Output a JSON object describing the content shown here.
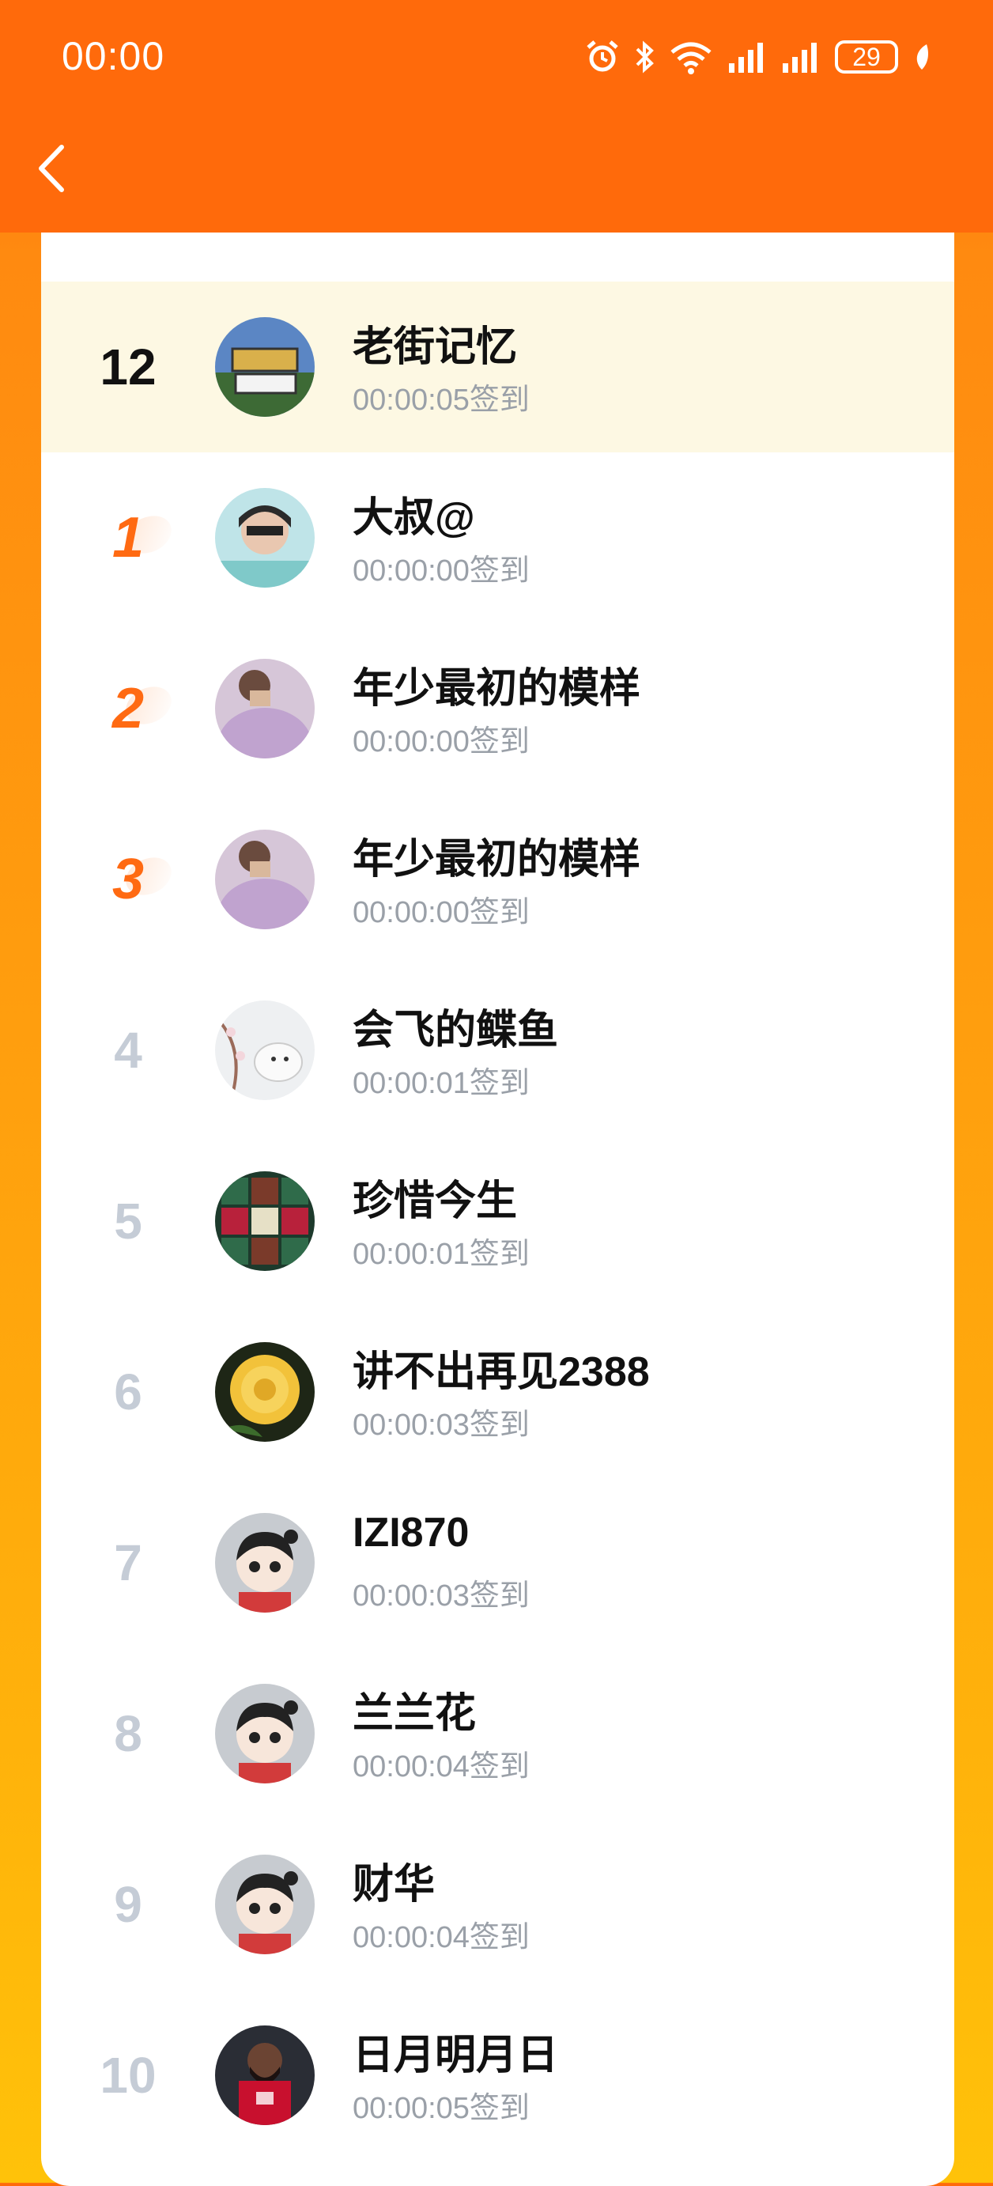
{
  "status_bar": {
    "time": "00:00",
    "battery": "29",
    "icons": [
      "alarm-icon",
      "bluetooth-icon",
      "wifi-icon",
      "signal-icon",
      "signal-icon",
      "battery-icon",
      "leaf-icon"
    ]
  },
  "nav": {
    "back_icon": "chevron-left-icon"
  },
  "colors": {
    "header": "#ff6a0b",
    "my_row": "#fdf8e3",
    "top_rank": "#ff6a12",
    "rank_gray": "#c5ccd6"
  },
  "my_entry": {
    "rank": "12",
    "name": "老街记忆",
    "time": "00:00:05签到"
  },
  "entries": [
    {
      "rank": "1",
      "name": "大叔@",
      "time": "00:00:00签到"
    },
    {
      "rank": "2",
      "name": "年少最初的模样",
      "time": "00:00:00签到"
    },
    {
      "rank": "3",
      "name": "年少最初的模样",
      "time": "00:00:00签到"
    },
    {
      "rank": "4",
      "name": "会飞的鲽鱼",
      "time": "00:00:01签到"
    },
    {
      "rank": "5",
      "name": "珍惜今生",
      "time": "00:00:01签到"
    },
    {
      "rank": "6",
      "name": "讲不出再见2388",
      "time": "00:00:03签到"
    },
    {
      "rank": "7",
      "name": "IZI870",
      "time": "00:00:03签到"
    },
    {
      "rank": "8",
      "name": "兰兰花",
      "time": "00:00:04签到"
    },
    {
      "rank": "9",
      "name": "财华",
      "time": "00:00:04签到"
    },
    {
      "rank": "10",
      "name": "日月明月日",
      "time": "00:00:05签到"
    }
  ]
}
